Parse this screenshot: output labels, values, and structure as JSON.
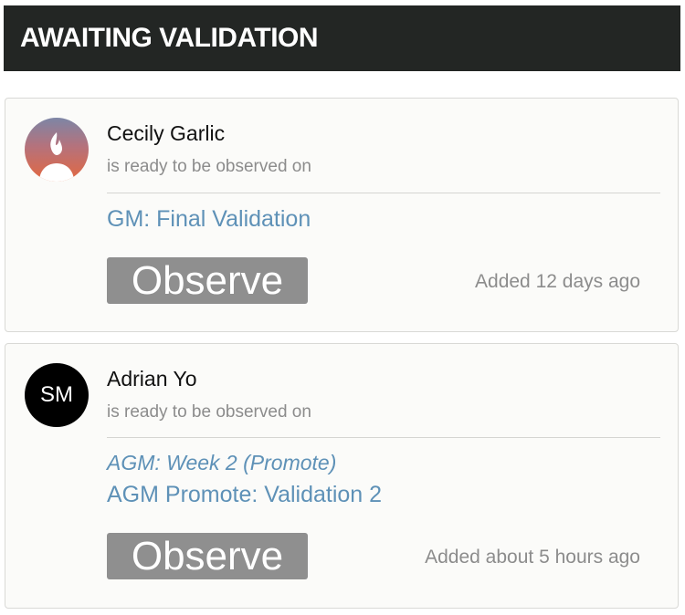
{
  "header": {
    "title": "AWAITING VALIDATION"
  },
  "cards": [
    {
      "name": "Cecily Garlic",
      "status_text": "is ready to be observed on",
      "link_label": "GM: Final Validation",
      "button_label": "Observe",
      "added_text": "Added 12 days ago",
      "avatar_icon": "fire-user-avatar-icon"
    },
    {
      "name": "Adrian Yo",
      "status_text": "is ready to be observed on",
      "sub_link_label": "AGM: Week 2 (Promote)",
      "link_label": "AGM Promote: Validation 2",
      "button_label": "Observe",
      "added_text": "Added about 5 hours ago",
      "avatar_initials": "SM"
    }
  ],
  "colors": {
    "header_bg": "#232624",
    "link": "#5e91b7",
    "button_bg": "#8f8f8f",
    "muted_text": "#8c8c8c"
  }
}
